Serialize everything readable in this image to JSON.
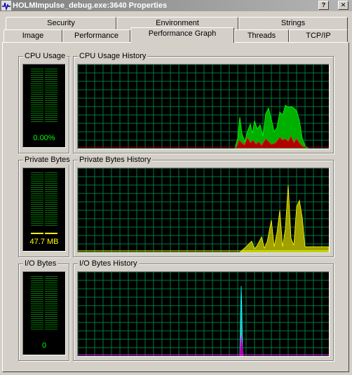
{
  "window": {
    "title": "HOLMImpulse_debug.exe:3640 Properties",
    "help_glyph": "?",
    "close_glyph": "✕"
  },
  "tabs": {
    "row_back": [
      {
        "label": "Security"
      },
      {
        "label": "Environment"
      },
      {
        "label": "Strings"
      }
    ],
    "row_front": [
      {
        "label": "Image"
      },
      {
        "label": "Performance"
      },
      {
        "label": "Performance Graph",
        "active": true
      },
      {
        "label": "Threads"
      },
      {
        "label": "TCP/IP"
      }
    ]
  },
  "cpu": {
    "meter_label": "CPU Usage",
    "meter_value": "0.00%",
    "meter_level": 0.0,
    "history_label": "CPU Usage History"
  },
  "private_bytes": {
    "meter_label": "Private Bytes",
    "meter_value": "47.7 MB",
    "meter_level": 0.14,
    "history_label": "Private Bytes History"
  },
  "io": {
    "meter_label": "I/O Bytes",
    "meter_value": "0",
    "meter_level": 0.0,
    "history_label": "I/O Bytes History"
  },
  "colors": {
    "grid": "#007a3d",
    "cpu_total": "#00c000",
    "cpu_kernel": "#c00000",
    "private_bytes": "#ffff00",
    "io_read": "#00ffff",
    "io_other": "#ff00ff",
    "meter_text": "#00ff00",
    "meter_text_yellow": "#ffff00"
  }
}
